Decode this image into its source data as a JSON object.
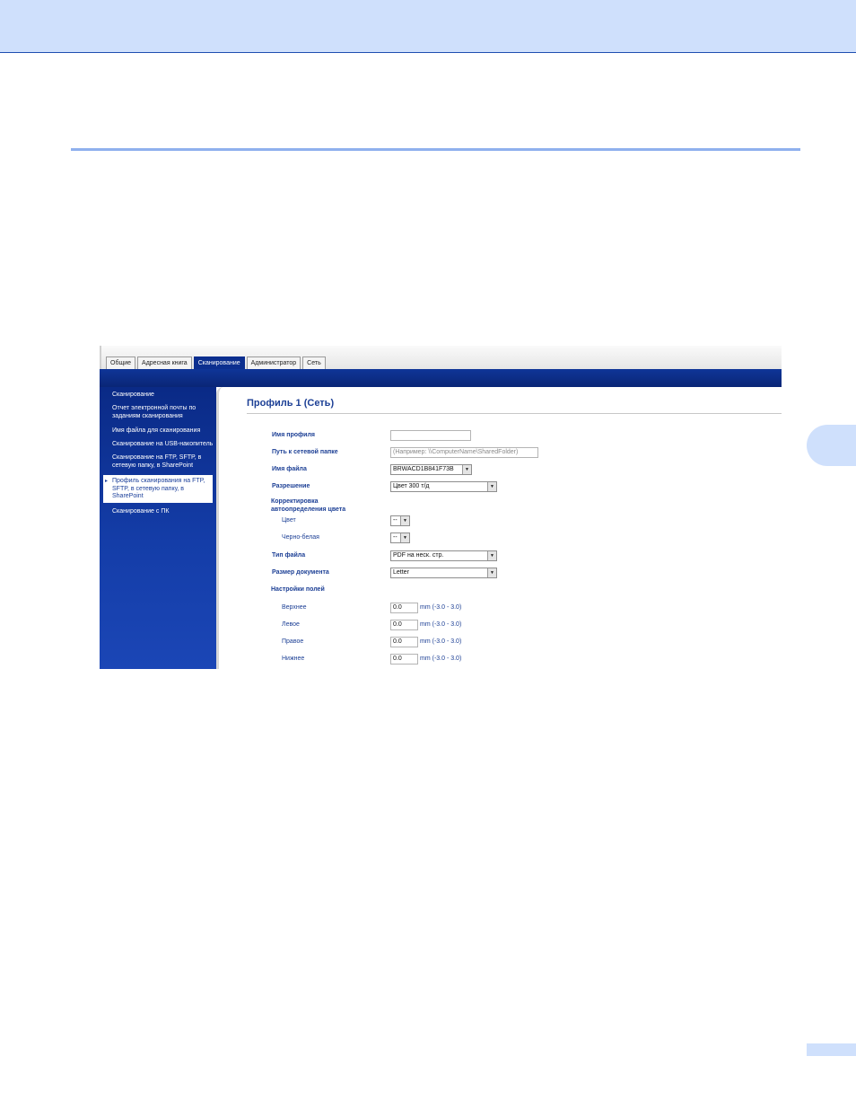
{
  "tabs": [
    "Общие",
    "Адресная книга",
    "Сканирование",
    "Администратор",
    "Сеть"
  ],
  "active_tab": "Сканирование",
  "sidebar": {
    "items": [
      "Сканирование",
      "Отчет электронной почты по заданиям сканирования",
      "Имя файла для сканирования",
      "Сканирование на USB-накопитель",
      "Сканирование на FTP, SFTP, в сетевую папку, в SharePoint",
      "Профиль сканирования на FTP, SFTP, в сетевую папку, в SharePoint",
      "Сканирование с ПК"
    ],
    "selected_index": 5
  },
  "form": {
    "title": "Профиль 1 (Сеть)",
    "profile_name_label": "Имя профиля",
    "profile_name_value": "",
    "network_path_label": "Путь к сетевой папке",
    "network_path_placeholder": "(Например: \\\\ComputerName\\SharedFolder)",
    "file_name_label": "Имя файла",
    "file_name_value": "BRWACD1B841F73B",
    "resolution_label": "Разрешение",
    "resolution_value": "Цвет 300 т/д",
    "auto_color_label": "Корректировка автоопределения цвета",
    "color_label": "Цвет",
    "color_value": "--",
    "bw_label": "Черно-белая",
    "bw_value": "--",
    "file_type_label": "Тип файла",
    "file_type_value": "PDF на неск. стр.",
    "doc_size_label": "Размер документа",
    "doc_size_value": "Letter",
    "margins_label": "Настройки полей",
    "margins": [
      {
        "label": "Верхнее",
        "value": "0.0",
        "range": "mm (-3.0 - 3.0)"
      },
      {
        "label": "Левое",
        "value": "0.0",
        "range": "mm (-3.0 - 3.0)"
      },
      {
        "label": "Правое",
        "value": "0.0",
        "range": "mm (-3.0 - 3.0)"
      },
      {
        "label": "Нижнее",
        "value": "0.0",
        "range": "mm (-3.0 - 3.0)"
      }
    ]
  },
  "icons": {
    "dropdown": "chevron-down-icon",
    "selected_marker": "triangle-right-icon"
  },
  "colors": {
    "accent": "#0c2f8f",
    "page_band": "#cfe0fc",
    "label": "#1c3f95"
  }
}
